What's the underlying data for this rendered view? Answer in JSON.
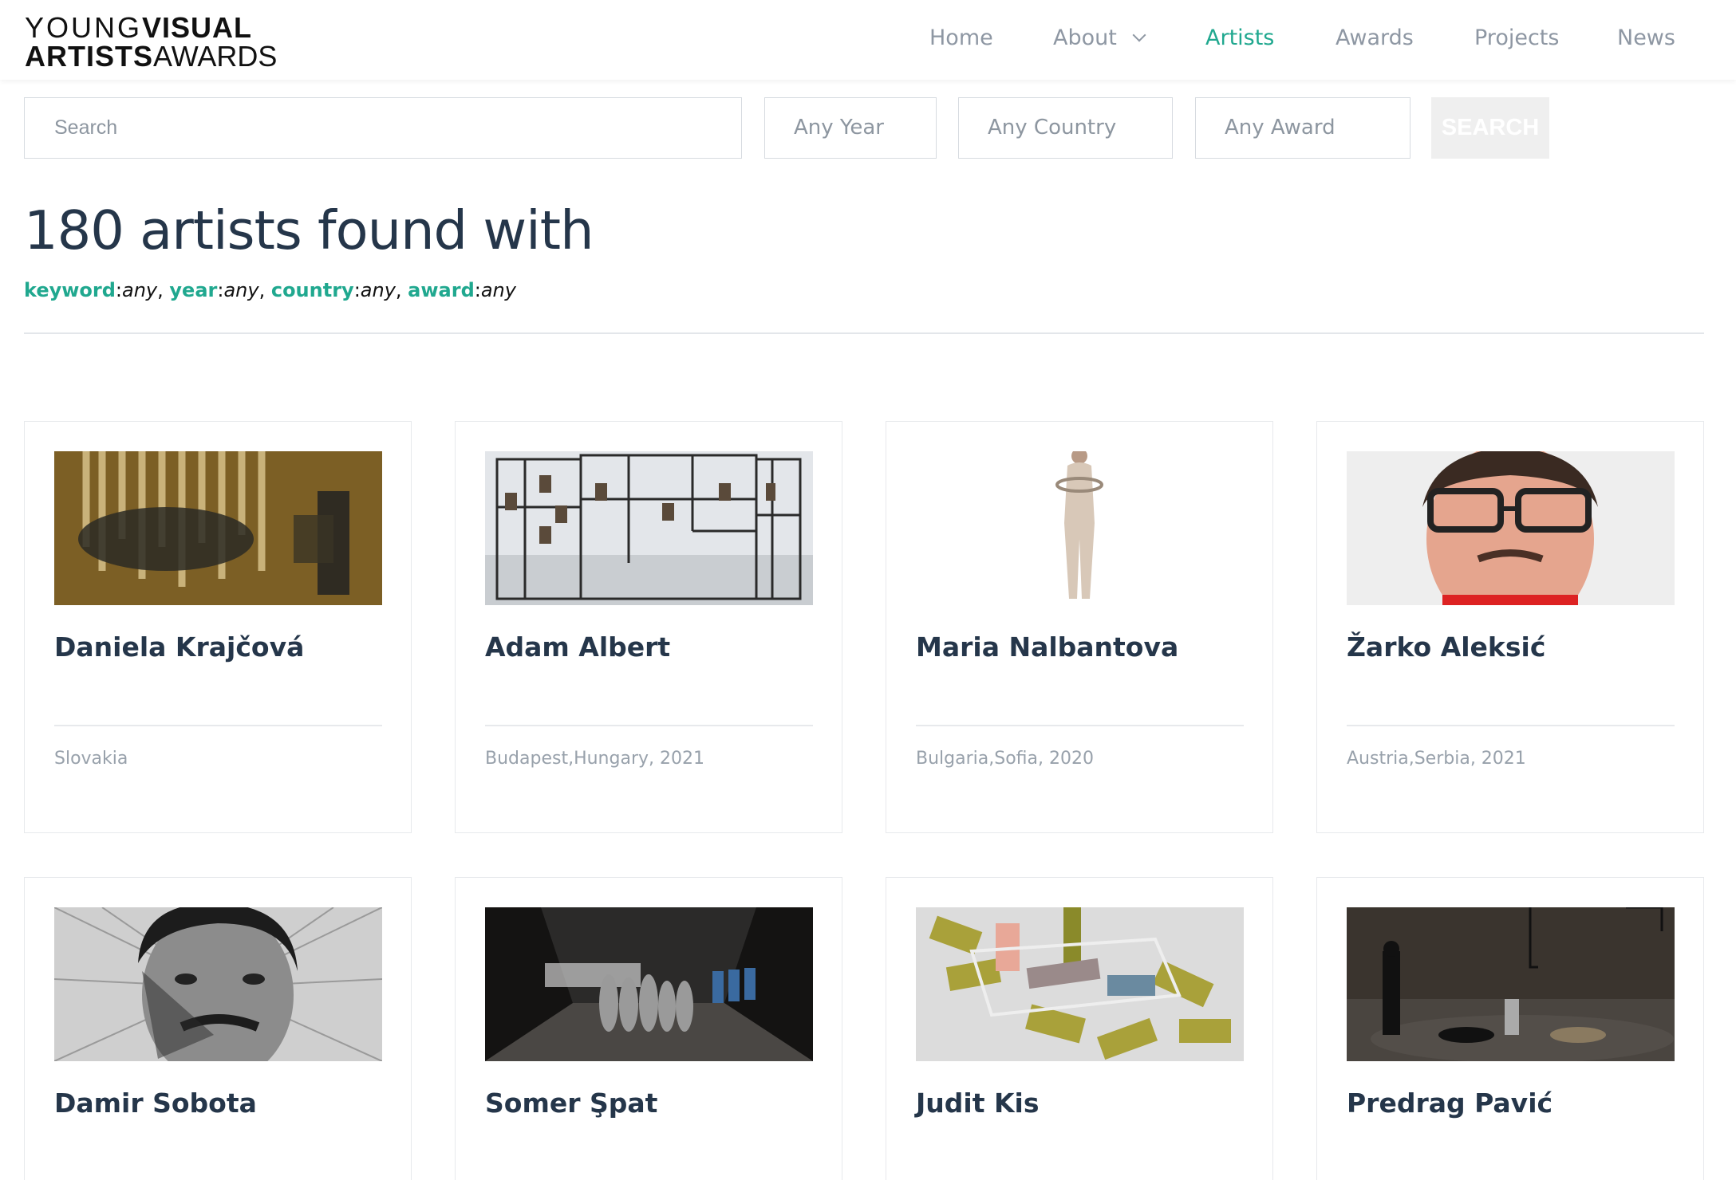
{
  "logo": {
    "line1_a": "YOUNG",
    "line1_b": "VISUAL",
    "line2_a": "ARTISTS",
    "line2_b": "AWARDS"
  },
  "nav": [
    {
      "label": "Home",
      "active": false
    },
    {
      "label": "About",
      "active": false
    },
    {
      "label": "Artists",
      "active": true
    },
    {
      "label": "Awards",
      "active": false
    },
    {
      "label": "Projects",
      "active": false
    },
    {
      "label": "News",
      "active": false
    }
  ],
  "search": {
    "placeholder": "Search",
    "year": "Any Year",
    "country": "Any Country",
    "award": "Any Award",
    "button": "SEARCH"
  },
  "results": {
    "title": "180 artists found with",
    "filters": [
      {
        "key": "keyword",
        "value": "any"
      },
      {
        "key": "year",
        "value": "any"
      },
      {
        "key": "country",
        "value": "any"
      },
      {
        "key": "award",
        "value": "any"
      }
    ]
  },
  "artists": [
    {
      "name": "Daniela Krajčová",
      "location": "Slovakia"
    },
    {
      "name": "Adam Albert",
      "location": "Budapest,Hungary, 2021"
    },
    {
      "name": "Maria Nalbantova",
      "location": "Bulgaria,Sofia, 2020"
    },
    {
      "name": "Žarko Aleksić",
      "location": "Austria,Serbia, 2021"
    },
    {
      "name": "Damir Sobota",
      "location": ""
    },
    {
      "name": "Somer Şpat",
      "location": ""
    },
    {
      "name": "Judit Kis",
      "location": ""
    },
    {
      "name": "Predrag Pavić",
      "location": ""
    }
  ],
  "colors": {
    "accent": "#20a88f",
    "heading": "#25364a",
    "muted": "#98a1ab"
  }
}
